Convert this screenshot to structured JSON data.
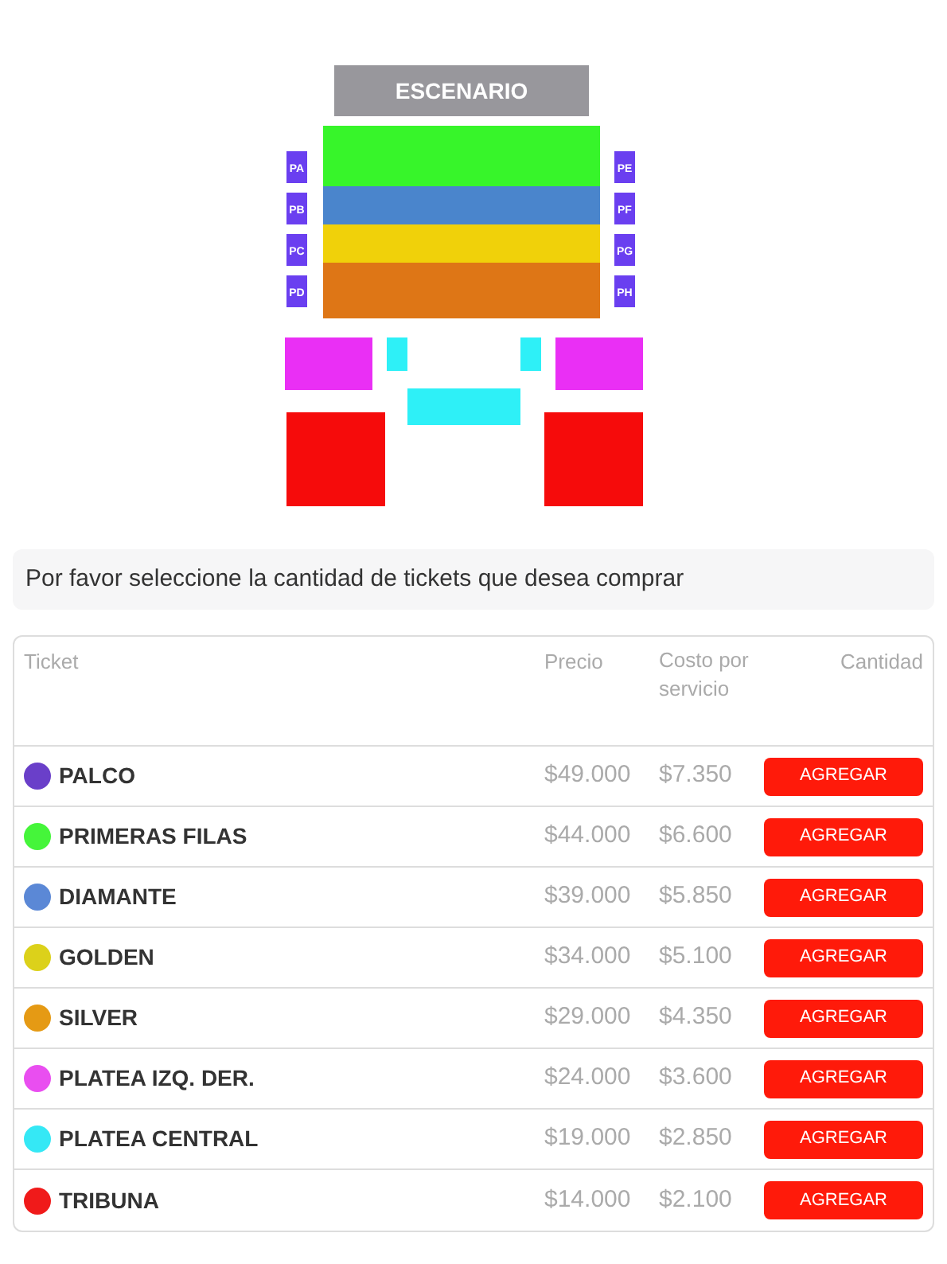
{
  "seat_map": {
    "stage": "ESCENARIO",
    "boxes_left": [
      "PA",
      "PB",
      "PC",
      "PD"
    ],
    "boxes_right": [
      "PE",
      "PF",
      "PG",
      "PH"
    ]
  },
  "prompt": "Por favor seleccione la cantidad de tickets que desea comprar",
  "table": {
    "columns": [
      "Ticket",
      "Precio",
      "Costo por servicio",
      "Cantidad"
    ],
    "rows": [
      {
        "ticket": "PALCO",
        "color": "#6a3fc9",
        "price": "$49.000",
        "fee": "$7.350",
        "action": "AGREGAR"
      },
      {
        "ticket": "PRIMERAS FILAS",
        "color": "#45f53a",
        "price": "$44.000",
        "fee": "$6.600",
        "action": "AGREGAR"
      },
      {
        "ticket": "DIAMANTE",
        "color": "#5b88d6",
        "price": "$39.000",
        "fee": "$5.850",
        "action": "AGREGAR"
      },
      {
        "ticket": "GOLDEN",
        "color": "#dcd11a",
        "price": "$34.000",
        "fee": "$5.100",
        "action": "AGREGAR"
      },
      {
        "ticket": "SILVER",
        "color": "#e59a14",
        "price": "$29.000",
        "fee": "$4.350",
        "action": "AGREGAR"
      },
      {
        "ticket": "PLATEA IZQ. DER.",
        "color": "#e94ef0",
        "price": "$24.000",
        "fee": "$3.600",
        "action": "AGREGAR"
      },
      {
        "ticket": "PLATEA CENTRAL",
        "color": "#35e8f5",
        "price": "$19.000",
        "fee": "$2.850",
        "action": "AGREGAR"
      },
      {
        "ticket": "TRIBUNA",
        "color": "#f01a1a",
        "price": "$14.000",
        "fee": "$2.100",
        "action": "AGREGAR"
      }
    ]
  }
}
